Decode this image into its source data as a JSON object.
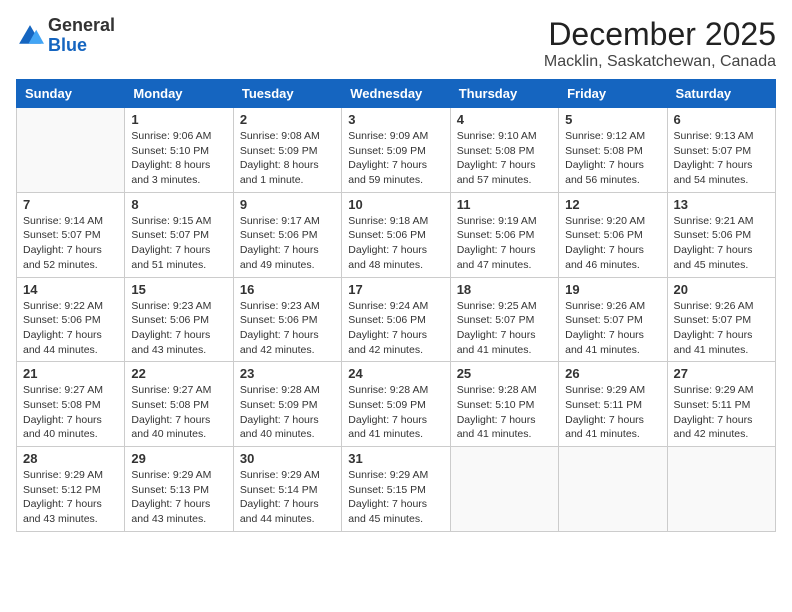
{
  "logo": {
    "general": "General",
    "blue": "Blue"
  },
  "header": {
    "month": "December 2025",
    "location": "Macklin, Saskatchewan, Canada"
  },
  "weekdays": [
    "Sunday",
    "Monday",
    "Tuesday",
    "Wednesday",
    "Thursday",
    "Friday",
    "Saturday"
  ],
  "weeks": [
    [
      {
        "day": "",
        "info": ""
      },
      {
        "day": "1",
        "info": "Sunrise: 9:06 AM\nSunset: 5:10 PM\nDaylight: 8 hours\nand 3 minutes."
      },
      {
        "day": "2",
        "info": "Sunrise: 9:08 AM\nSunset: 5:09 PM\nDaylight: 8 hours\nand 1 minute."
      },
      {
        "day": "3",
        "info": "Sunrise: 9:09 AM\nSunset: 5:09 PM\nDaylight: 7 hours\nand 59 minutes."
      },
      {
        "day": "4",
        "info": "Sunrise: 9:10 AM\nSunset: 5:08 PM\nDaylight: 7 hours\nand 57 minutes."
      },
      {
        "day": "5",
        "info": "Sunrise: 9:12 AM\nSunset: 5:08 PM\nDaylight: 7 hours\nand 56 minutes."
      },
      {
        "day": "6",
        "info": "Sunrise: 9:13 AM\nSunset: 5:07 PM\nDaylight: 7 hours\nand 54 minutes."
      }
    ],
    [
      {
        "day": "7",
        "info": "Sunrise: 9:14 AM\nSunset: 5:07 PM\nDaylight: 7 hours\nand 52 minutes."
      },
      {
        "day": "8",
        "info": "Sunrise: 9:15 AM\nSunset: 5:07 PM\nDaylight: 7 hours\nand 51 minutes."
      },
      {
        "day": "9",
        "info": "Sunrise: 9:17 AM\nSunset: 5:06 PM\nDaylight: 7 hours\nand 49 minutes."
      },
      {
        "day": "10",
        "info": "Sunrise: 9:18 AM\nSunset: 5:06 PM\nDaylight: 7 hours\nand 48 minutes."
      },
      {
        "day": "11",
        "info": "Sunrise: 9:19 AM\nSunset: 5:06 PM\nDaylight: 7 hours\nand 47 minutes."
      },
      {
        "day": "12",
        "info": "Sunrise: 9:20 AM\nSunset: 5:06 PM\nDaylight: 7 hours\nand 46 minutes."
      },
      {
        "day": "13",
        "info": "Sunrise: 9:21 AM\nSunset: 5:06 PM\nDaylight: 7 hours\nand 45 minutes."
      }
    ],
    [
      {
        "day": "14",
        "info": "Sunrise: 9:22 AM\nSunset: 5:06 PM\nDaylight: 7 hours\nand 44 minutes."
      },
      {
        "day": "15",
        "info": "Sunrise: 9:23 AM\nSunset: 5:06 PM\nDaylight: 7 hours\nand 43 minutes."
      },
      {
        "day": "16",
        "info": "Sunrise: 9:23 AM\nSunset: 5:06 PM\nDaylight: 7 hours\nand 42 minutes."
      },
      {
        "day": "17",
        "info": "Sunrise: 9:24 AM\nSunset: 5:06 PM\nDaylight: 7 hours\nand 42 minutes."
      },
      {
        "day": "18",
        "info": "Sunrise: 9:25 AM\nSunset: 5:07 PM\nDaylight: 7 hours\nand 41 minutes."
      },
      {
        "day": "19",
        "info": "Sunrise: 9:26 AM\nSunset: 5:07 PM\nDaylight: 7 hours\nand 41 minutes."
      },
      {
        "day": "20",
        "info": "Sunrise: 9:26 AM\nSunset: 5:07 PM\nDaylight: 7 hours\nand 41 minutes."
      }
    ],
    [
      {
        "day": "21",
        "info": "Sunrise: 9:27 AM\nSunset: 5:08 PM\nDaylight: 7 hours\nand 40 minutes."
      },
      {
        "day": "22",
        "info": "Sunrise: 9:27 AM\nSunset: 5:08 PM\nDaylight: 7 hours\nand 40 minutes."
      },
      {
        "day": "23",
        "info": "Sunrise: 9:28 AM\nSunset: 5:09 PM\nDaylight: 7 hours\nand 40 minutes."
      },
      {
        "day": "24",
        "info": "Sunrise: 9:28 AM\nSunset: 5:09 PM\nDaylight: 7 hours\nand 41 minutes."
      },
      {
        "day": "25",
        "info": "Sunrise: 9:28 AM\nSunset: 5:10 PM\nDaylight: 7 hours\nand 41 minutes."
      },
      {
        "day": "26",
        "info": "Sunrise: 9:29 AM\nSunset: 5:11 PM\nDaylight: 7 hours\nand 41 minutes."
      },
      {
        "day": "27",
        "info": "Sunrise: 9:29 AM\nSunset: 5:11 PM\nDaylight: 7 hours\nand 42 minutes."
      }
    ],
    [
      {
        "day": "28",
        "info": "Sunrise: 9:29 AM\nSunset: 5:12 PM\nDaylight: 7 hours\nand 43 minutes."
      },
      {
        "day": "29",
        "info": "Sunrise: 9:29 AM\nSunset: 5:13 PM\nDaylight: 7 hours\nand 43 minutes."
      },
      {
        "day": "30",
        "info": "Sunrise: 9:29 AM\nSunset: 5:14 PM\nDaylight: 7 hours\nand 44 minutes."
      },
      {
        "day": "31",
        "info": "Sunrise: 9:29 AM\nSunset: 5:15 PM\nDaylight: 7 hours\nand 45 minutes."
      },
      {
        "day": "",
        "info": ""
      },
      {
        "day": "",
        "info": ""
      },
      {
        "day": "",
        "info": ""
      }
    ]
  ]
}
